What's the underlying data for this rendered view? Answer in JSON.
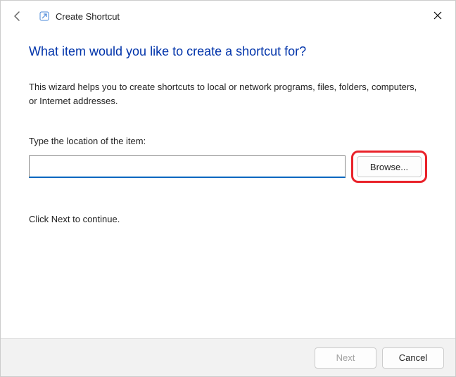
{
  "titlebar": {
    "title": "Create Shortcut"
  },
  "heading": "What item would you like to create a shortcut for?",
  "description": "This wizard helps you to create shortcuts to local or network programs, files, folders, computers, or Internet addresses.",
  "field": {
    "label": "Type the location of the item:",
    "value": "",
    "placeholder": ""
  },
  "browse_label": "Browse...",
  "continue_text": "Click Next to continue.",
  "footer": {
    "next_label": "Next",
    "cancel_label": "Cancel",
    "next_enabled": false
  }
}
